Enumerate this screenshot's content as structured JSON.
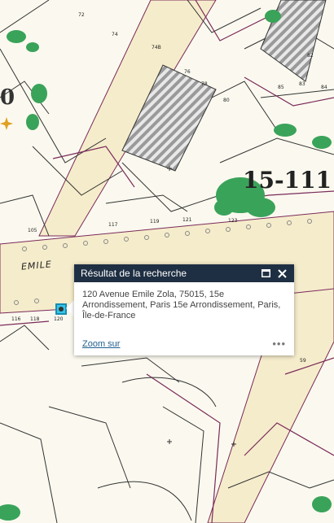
{
  "map": {
    "street_label": "EMILE",
    "parcel_label": "15-111",
    "partial_label": "0",
    "numbers": [
      "72",
      "74",
      "74B",
      "76",
      "78",
      "80",
      "82",
      "83",
      "84",
      "85",
      "117",
      "119",
      "121",
      "116",
      "118",
      "120",
      "59",
      "105",
      "123"
    ]
  },
  "popup": {
    "title": "Résultat de la recherche",
    "body": "120 Avenue Emile Zola, 75015, 15e Arrondissement, Paris 15e Arrondissement, Paris, Île-de-France",
    "zoom_label": "Zoom sur",
    "more_label": "•••",
    "maximize_icon": "maximize-icon",
    "close_icon": "close-icon"
  },
  "colors": {
    "road": "#f5eccb",
    "parcel_line": "#7a2a5a",
    "vegetation": "#3aa35a",
    "popup_header": "#1f2f43"
  }
}
